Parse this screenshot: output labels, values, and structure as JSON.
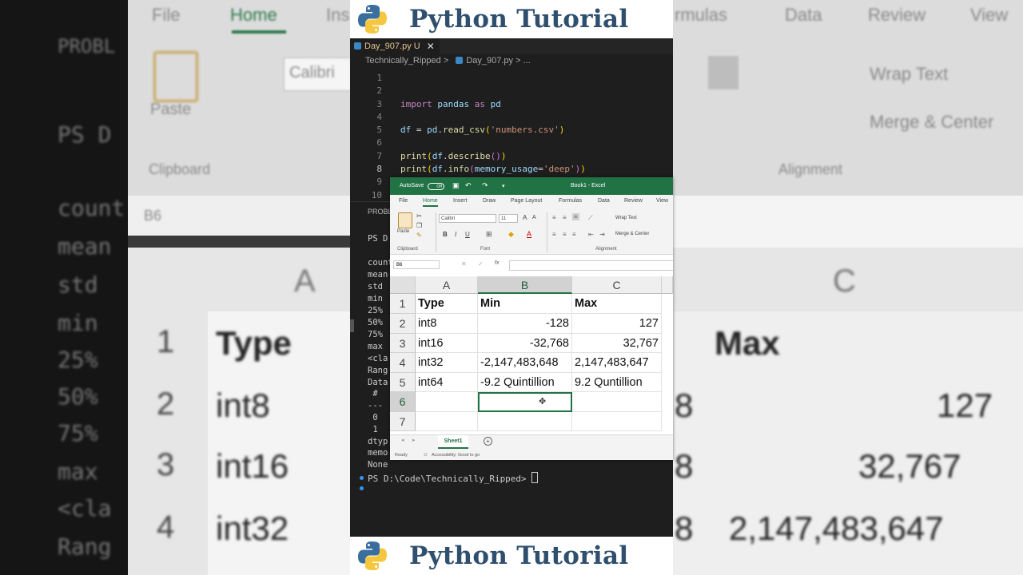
{
  "banner": {
    "title": "Python Tutorial"
  },
  "editor": {
    "tab_label": "Day_907.py U",
    "tab_close": "✕",
    "breadcrumb": {
      "folder": "Technically_Ripped",
      "sep1": ">",
      "file": "Day_907.py",
      "sep2": "> ..."
    },
    "lines": [
      "1",
      "2",
      "3",
      "4",
      "5",
      "6",
      "7",
      "8",
      "9",
      "10"
    ],
    "code": {
      "l3": {
        "kw1": "import",
        "mod": "pandas",
        "kw2": "as",
        "alias": "pd"
      },
      "l5": {
        "var": "df",
        "eq": " = ",
        "mod": "pd",
        "dot": ".",
        "fn": "read_csv",
        "open": "(",
        "arg": "'numbers.csv'",
        "close": ")"
      },
      "l7": {
        "fn": "print",
        "open": "(",
        "var": "df",
        "dot": ".",
        "fn2": "describe",
        "inner": "()",
        "close": ")"
      },
      "l8": {
        "fn": "print",
        "open": "(",
        "var": "df",
        "dot": ".",
        "fn2": "info",
        "open2": "(",
        "kw": "memory_usage",
        "eq": "=",
        "arg": "'deep'",
        "close2": ")",
        "close": ")"
      }
    }
  },
  "terminal": {
    "tab": "PROBL",
    "ps_partial": "PS D",
    "rows": [
      "count",
      "mean",
      "std",
      "min",
      "25%",
      "50%",
      "75%",
      "max",
      "<cla",
      "Rang",
      "Data",
      " #",
      "---",
      " 0",
      " 1",
      "dtyp",
      "memo",
      "None"
    ],
    "prompt": "PS D:\\Code\\Technically_Ripped>"
  },
  "excel": {
    "autosave": "AutoSave",
    "autosave_state": "Off",
    "window_title": "Book1 - Excel",
    "tabs": [
      "File",
      "Home",
      "Insert",
      "Draw",
      "Page Layout",
      "Formulas",
      "Data",
      "Review",
      "View"
    ],
    "font_name": "Calibri",
    "font_size": "11",
    "paste": "Paste",
    "wrap_text": "Wrap Text",
    "merge_center": "Merge & Center",
    "groups": {
      "clipboard": "Clipboard",
      "font": "Font",
      "alignment": "Alignment"
    },
    "name_box": "B6",
    "fx": "fx",
    "columns": [
      "A",
      "B",
      "C"
    ],
    "rows": [
      "1",
      "2",
      "3",
      "4",
      "5",
      "6",
      "7"
    ],
    "cells": [
      [
        "Type",
        "Min",
        "Max"
      ],
      [
        "int8",
        "-128",
        "127"
      ],
      [
        "int16",
        "-32,768",
        "32,767"
      ],
      [
        "int32",
        "-2,147,483,648",
        "2,147,483,647"
      ],
      [
        "int64",
        "-9.2 Quintillion",
        "9.2 Quntillion"
      ],
      [
        "",
        "",
        ""
      ],
      [
        "",
        "",
        ""
      ]
    ],
    "sheet_tab": "Sheet1",
    "add_sheet": "+",
    "status_ready": "Ready",
    "status_accessibility": "Accessibility: Good to go"
  },
  "background": {
    "left_tab": "File",
    "left_problem": "PROBL",
    "left_ps": "PS D",
    "left_rows": [
      "count",
      "mean",
      "std",
      "min",
      "25%",
      "50%",
      "75%",
      "max",
      "<cla",
      "Rang"
    ],
    "left_clipboard": "Clipboard",
    "left_paste": "Paste",
    "left_font": "Calibri",
    "left_namebox": "B6",
    "left_col": "A",
    "left_rownums": [
      "1",
      "2",
      "3",
      "4"
    ],
    "left_cells": [
      "Type",
      "int8",
      "int16",
      "int32"
    ],
    "left_home": "Home",
    "left_ins": "Ins",
    "right_tabs": [
      "rmulas",
      "Data",
      "Review",
      "View"
    ],
    "right_wrap": "Wrap Text",
    "right_merge": "Merge & Center",
    "right_alignment": "Alignment",
    "right_col": "C",
    "right_cells": [
      "Max",
      "127",
      "32,767",
      "2,147,483,647"
    ],
    "right_frag": [
      "8",
      "8",
      "8"
    ]
  },
  "colors": {
    "excel_green": "#217346",
    "vscode_bg": "#1e1e1e",
    "banner_text": "#2f4f6f"
  }
}
